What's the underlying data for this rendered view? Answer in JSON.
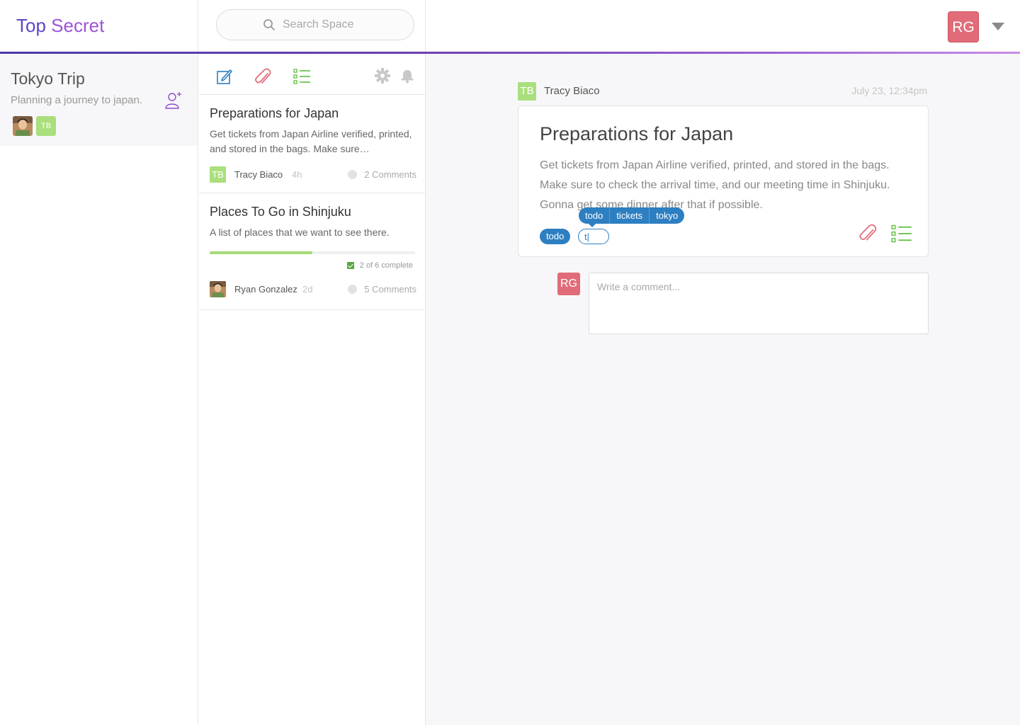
{
  "app": {
    "brand_word1": "Top",
    "brand_word2": "Secret"
  },
  "search": {
    "placeholder": "Search Space"
  },
  "current_user": {
    "initials": "RG",
    "color": "#e16b78"
  },
  "space": {
    "title": "Tokyo Trip",
    "description": "Planning a journey to japan.",
    "members": [
      {
        "type": "photo"
      },
      {
        "initials": "TB"
      }
    ]
  },
  "toolbar": {
    "tools": [
      "new-note",
      "attachment",
      "checklist",
      "settings",
      "notifications"
    ]
  },
  "notes": [
    {
      "title": "Preparations for Japan",
      "excerpt": "Get tickets from Japan Airline verified, printed, and stored in the bags. Make sure…",
      "author_initials": "TB",
      "author": "Tracy Biaco",
      "ago": "4h",
      "comments": "2 Comments"
    },
    {
      "title": "Places To Go in Shinjuku",
      "excerpt": "A list of places that we want to see there.",
      "progress": 0.5,
      "progress_text": "2 of 6 complete",
      "author": "Ryan Gonzalez",
      "ago": "2d",
      "comments": "5 Comments"
    }
  ],
  "post": {
    "author_initials": "TB",
    "author": "Tracy Biaco",
    "date": "July 23, 12:34pm",
    "title": "Preparations for Japan",
    "body": "Get tickets from Japan Airline verified, printed, and stored in the bags. Make sure to check the arrival time, and our meeting time in Shinjuku. Gonna get some dinner after that if possible.",
    "tags": [
      "todo"
    ],
    "tag_input_value": "t|",
    "tag_suggestions": [
      "todo",
      "tickets",
      "tokyo"
    ]
  },
  "comment": {
    "user_initials": "RG",
    "placeholder": "Write a comment..."
  },
  "colors": {
    "accent_blue": "#2d7fc2",
    "accent_green": "#a9df7d",
    "accent_purple": "#9b54d8",
    "accent_red": "#e16b78"
  }
}
